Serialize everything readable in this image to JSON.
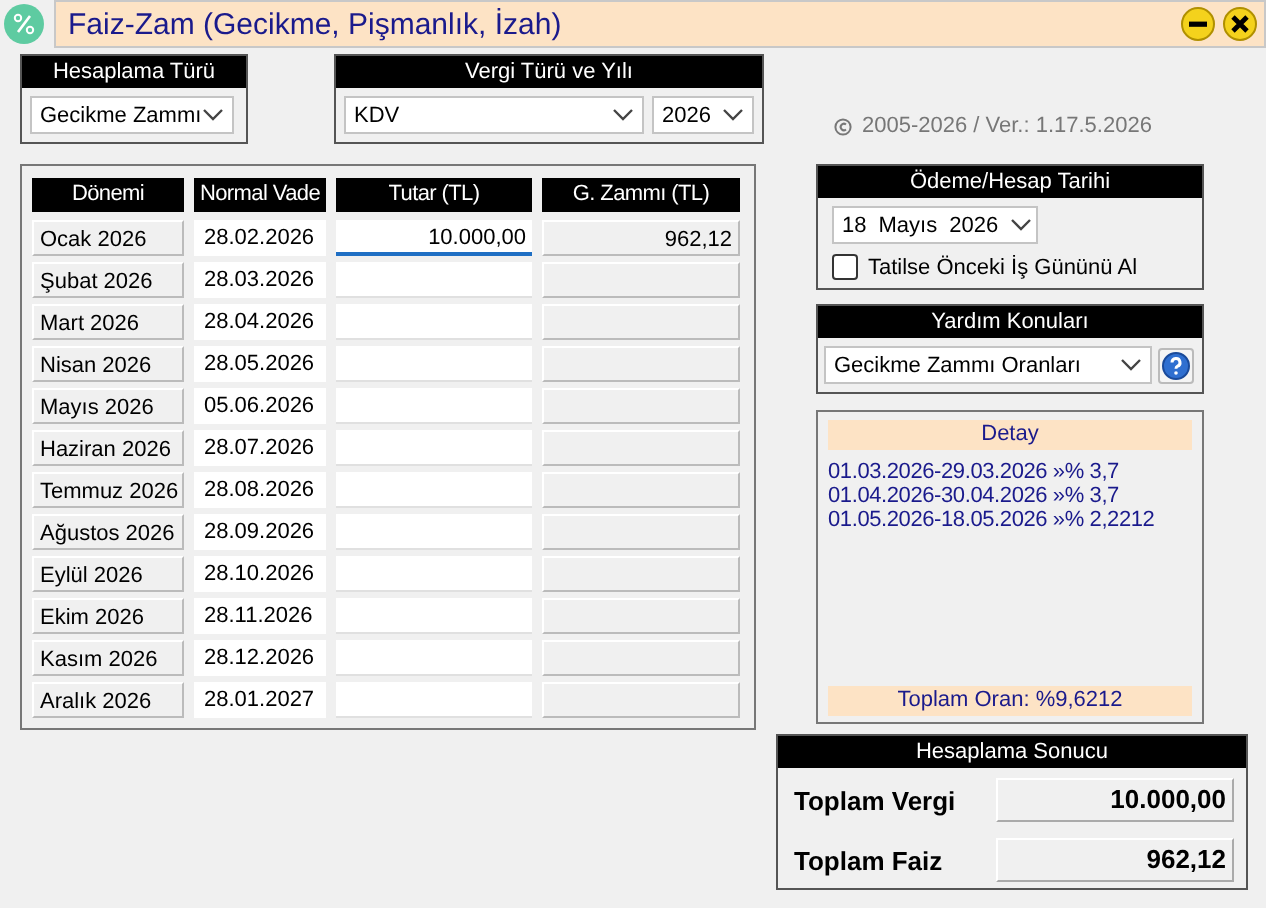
{
  "window": {
    "title": "Faiz-Zam (Gecikme, Pişmanlık, İzah)"
  },
  "calc_type": {
    "label": "Hesaplama Türü",
    "value": "Gecikme Zammı"
  },
  "tax": {
    "label": "Vergi Türü ve Yılı",
    "type_value": "KDV",
    "year_value": "2026"
  },
  "copyright": "2005-2026 / Ver.: 1.17.5.2026",
  "table": {
    "columns": [
      "Dönemi",
      "Normal Vade",
      "Tutar (TL)",
      "G. Zammı (TL)"
    ],
    "rows": [
      {
        "period": "Ocak 2026",
        "due": "28.02.2026",
        "amount": "10.000,00",
        "surcharge": "962,12",
        "focused": true
      },
      {
        "period": "Şubat 2026",
        "due": "28.03.2026",
        "focused": false
      },
      {
        "period": "Mart 2026",
        "due": "28.04.2026",
        "focused": false
      },
      {
        "period": "Nisan 2026",
        "due": "28.05.2026",
        "focused": false
      },
      {
        "period": "Mayıs 2026",
        "due": "05.06.2026",
        "focused": false
      },
      {
        "period": "Haziran 2026",
        "due": "28.07.2026",
        "focused": false
      },
      {
        "period": "Temmuz 2026",
        "due": "28.08.2026",
        "focused": false
      },
      {
        "period": "Ağustos 2026",
        "due": "28.09.2026",
        "focused": false
      },
      {
        "period": "Eylül 2026",
        "due": "28.10.2026",
        "focused": false
      },
      {
        "period": "Ekim 2026",
        "due": "28.11.2026",
        "focused": false
      },
      {
        "period": "Kasım 2026",
        "due": "28.12.2026",
        "focused": false
      },
      {
        "period": "Aralık 2026",
        "due": "28.01.2027",
        "focused": false
      }
    ]
  },
  "payment_date": {
    "label": "Ödeme/Hesap Tarihi",
    "day": "18",
    "month": "Mayıs",
    "year": "2026",
    "checkbox": {
      "label": "Tatilse Önceki İş Gününü Al",
      "checked": false
    }
  },
  "help": {
    "label": "Yardım Konuları",
    "value": "Gecikme Zammı Oranları"
  },
  "detail": {
    "title": "Detay",
    "lines": [
      "01.03.2026-29.03.2026 »% 3,7",
      "01.04.2026-30.04.2026 »% 3,7",
      "01.05.2026-18.05.2026 »% 2,2212"
    ],
    "total": "Toplam Oran: %9,6212"
  },
  "result": {
    "title": "Hesaplama Sonucu",
    "rows": [
      {
        "label": "Toplam Vergi",
        "value": "10.000,00"
      },
      {
        "label": "Toplam Faiz",
        "value": "962,12"
      }
    ]
  }
}
